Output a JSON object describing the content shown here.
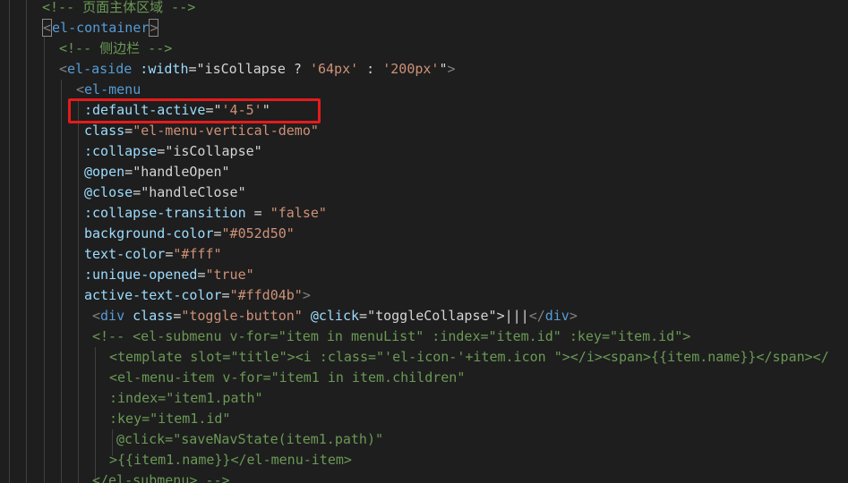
{
  "editor": {
    "lines": [
      [
        {
          "t": "<!-- 页面主体区域 -->",
          "c": "comment"
        }
      ],
      [
        {
          "t": "<",
          "c": "punct",
          "box": true
        },
        {
          "t": "el-container",
          "c": "tag"
        },
        {
          "t": ">",
          "c": "punct",
          "box": true
        }
      ],
      [
        {
          "t": "<!-- 侧边栏 -->",
          "c": "comment"
        }
      ],
      [
        {
          "t": "<",
          "c": "punct"
        },
        {
          "t": "el-aside",
          "c": "tag"
        },
        {
          "t": " :width",
          "c": "attr"
        },
        {
          "t": "=",
          "c": "plain"
        },
        {
          "t": "\"isCollapse ? ",
          "c": "plain"
        },
        {
          "t": "'64px'",
          "c": "string"
        },
        {
          "t": " : ",
          "c": "plain"
        },
        {
          "t": "'200px'",
          "c": "string"
        },
        {
          "t": "\"",
          "c": "plain"
        },
        {
          "t": ">",
          "c": "punct"
        }
      ],
      [
        {
          "t": "<",
          "c": "punct"
        },
        {
          "t": "el-menu",
          "c": "tag"
        }
      ],
      [
        {
          "t": ":default-active",
          "c": "attr"
        },
        {
          "t": "=",
          "c": "plain"
        },
        {
          "t": "\"",
          "c": "plain"
        },
        {
          "t": "'4-5'",
          "c": "string"
        },
        {
          "t": "\"",
          "c": "plain"
        }
      ],
      [
        {
          "t": "class",
          "c": "attr"
        },
        {
          "t": "=",
          "c": "plain"
        },
        {
          "t": "\"el-menu-vertical-demo\"",
          "c": "string"
        }
      ],
      [
        {
          "t": ":collapse",
          "c": "attr"
        },
        {
          "t": "=",
          "c": "plain"
        },
        {
          "t": "\"isCollapse\"",
          "c": "plain"
        }
      ],
      [
        {
          "t": "@open",
          "c": "attr"
        },
        {
          "t": "=",
          "c": "plain"
        },
        {
          "t": "\"handleOpen\"",
          "c": "plain"
        }
      ],
      [
        {
          "t": "@close",
          "c": "attr"
        },
        {
          "t": "=",
          "c": "plain"
        },
        {
          "t": "\"handleClose\"",
          "c": "plain"
        }
      ],
      [
        {
          "t": ":collapse-transition",
          "c": "attr"
        },
        {
          "t": " = ",
          "c": "plain"
        },
        {
          "t": "\"false\"",
          "c": "string"
        }
      ],
      [
        {
          "t": "background-color",
          "c": "attr"
        },
        {
          "t": "=",
          "c": "plain"
        },
        {
          "t": "\"#052d50\"",
          "c": "string"
        }
      ],
      [
        {
          "t": "text-color",
          "c": "attr"
        },
        {
          "t": "=",
          "c": "plain"
        },
        {
          "t": "\"#fff\"",
          "c": "string"
        }
      ],
      [
        {
          "t": ":unique-opened",
          "c": "attr"
        },
        {
          "t": "=",
          "c": "plain"
        },
        {
          "t": "\"true\"",
          "c": "string"
        }
      ],
      [
        {
          "t": "active-text-color",
          "c": "attr"
        },
        {
          "t": "=",
          "c": "plain"
        },
        {
          "t": "\"#ffd04b\"",
          "c": "string"
        },
        {
          "t": ">",
          "c": "punct"
        }
      ],
      [
        {
          "t": "<",
          "c": "punct"
        },
        {
          "t": "div",
          "c": "tag"
        },
        {
          "t": " class",
          "c": "attr"
        },
        {
          "t": "=",
          "c": "plain"
        },
        {
          "t": "\"toggle-button\"",
          "c": "string"
        },
        {
          "t": " @click",
          "c": "attr"
        },
        {
          "t": "=",
          "c": "plain"
        },
        {
          "t": "\"toggleCollapse\"",
          "c": "plain"
        },
        {
          "t": ">|||",
          "c": "plain"
        },
        {
          "t": "</",
          "c": "punct"
        },
        {
          "t": "div",
          "c": "tag"
        },
        {
          "t": ">",
          "c": "punct"
        }
      ],
      [
        {
          "t": "<!-- <el-submenu v-for=\"item in menuList\" :index=\"item.id\" :key=\"item.id\">",
          "c": "comment"
        }
      ],
      [
        {
          "t": "<template slot=\"title\"><i :class=\"'el-icon-'+item.icon \"></i><span>{{item.name}}</span></",
          "c": "comment"
        }
      ],
      [
        {
          "t": "<el-menu-item v-for=\"item1 in item.children\"",
          "c": "comment"
        }
      ],
      [
        {
          "t": ":index=\"item1.path\"",
          "c": "comment"
        }
      ],
      [
        {
          "t": ":key=\"item1.id\"",
          "c": "comment"
        }
      ],
      [
        {
          "t": "@click=\"saveNavState(item1.path)\"",
          "c": "comment"
        }
      ],
      [
        {
          "t": ">{{item1.name}}</el-menu-item>",
          "c": "comment"
        }
      ],
      [
        {
          "t": "</el-submenu> -->",
          "c": "comment"
        }
      ]
    ]
  }
}
